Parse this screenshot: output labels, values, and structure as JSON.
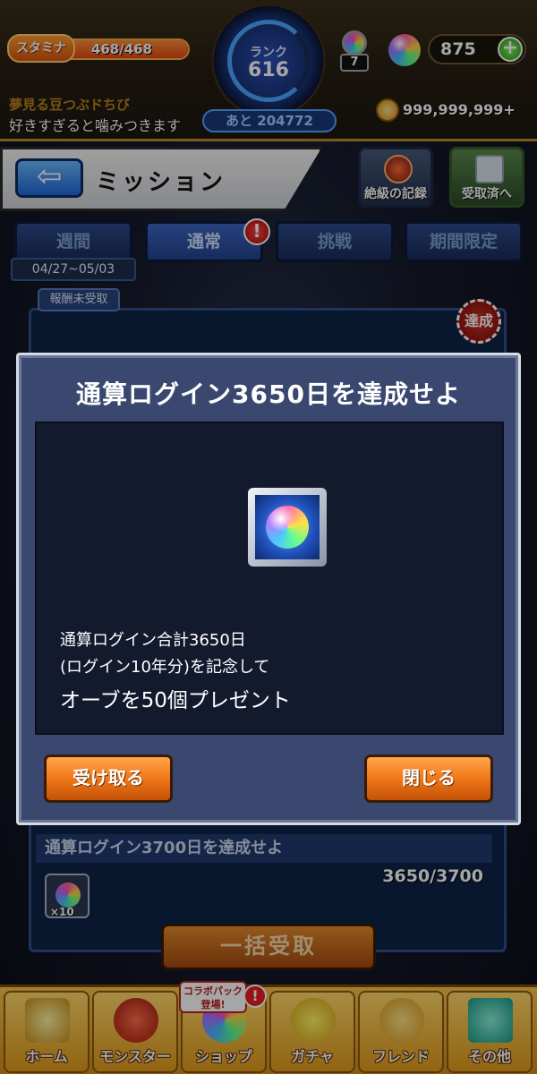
{
  "header": {
    "stamina_label": "スタミナ",
    "stamina_value": "468/468",
    "stamina_fraction": 1.0,
    "rank_label": "ランク",
    "rank_value": "616",
    "rank_next": "あと 204772",
    "stamina_item_count": "7",
    "orb_count": "875",
    "plus_label": "+",
    "player_name": "夢見る豆つぶドちび",
    "player_message": "好きすぎると噛みつきます",
    "gold": "999,999,999+"
  },
  "titlebar": {
    "title": "ミッション",
    "records_label": "絶級の記録",
    "received_label": "受取済へ"
  },
  "tabs": [
    {
      "label": "週間"
    },
    {
      "label": "通常"
    },
    {
      "label": "挑戦"
    },
    {
      "label": "期間限定"
    }
  ],
  "tab_badge": "!",
  "date_range": "04/27~05/03",
  "unreceived_label": "報酬未受取",
  "achieved_stamp": "達成",
  "list": {
    "row_title": "通算ログイン3700日を達成せよ",
    "row_progress": "3650/3700",
    "row_reward_qty": "×10"
  },
  "bulk_label": "一括受取",
  "modal": {
    "title": "通算ログイン3650日を達成せよ",
    "desc_line1": "通算ログイン合計3650日",
    "desc_line2": "(ログイン10年分)を記念して",
    "desc_line3": "オーブを50個プレゼント",
    "receive_label": "受け取る",
    "close_label": "閉じる"
  },
  "nav": {
    "items": [
      {
        "label": "ホーム"
      },
      {
        "label": "モンスター"
      },
      {
        "label": "ショップ"
      },
      {
        "label": "ガチャ"
      },
      {
        "label": "フレンド"
      },
      {
        "label": "その他"
      }
    ],
    "collab_line1": "コラボパック",
    "collab_line2": "登場!",
    "collab_badge": "!"
  }
}
